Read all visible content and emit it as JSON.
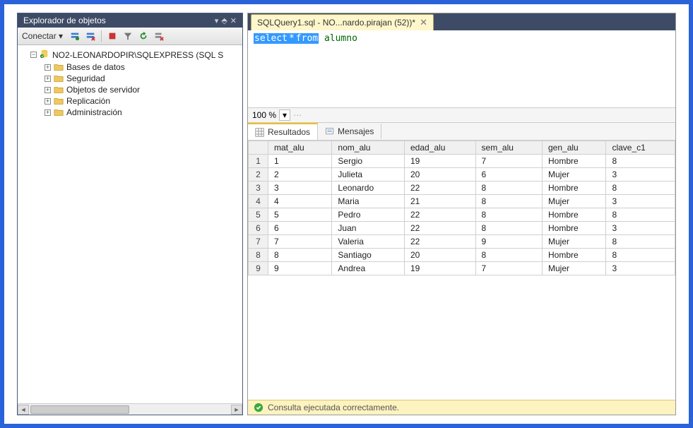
{
  "explorer": {
    "title": "Explorador de objetos",
    "connect_label": "Conectar ▾",
    "root_label": "NO2-LEONARDOPIR\\SQLEXPRESS (SQL S",
    "items": [
      {
        "label": "Bases de datos"
      },
      {
        "label": "Seguridad"
      },
      {
        "label": "Objetos de servidor"
      },
      {
        "label": "Replicación"
      },
      {
        "label": "Administración"
      }
    ]
  },
  "editor_tab": {
    "title": "SQLQuery1.sql - NO...nardo.pirajan (52))*"
  },
  "sql": {
    "keyword1": "select",
    "op": "*",
    "keyword2": "from",
    "ident": "alumno"
  },
  "zoom": {
    "value": "100 %"
  },
  "result_tabs": {
    "results": "Resultados",
    "messages": "Mensajes"
  },
  "grid": {
    "columns": [
      "mat_alu",
      "nom_alu",
      "edad_alu",
      "sem_alu",
      "gen_alu",
      "clave_c1"
    ],
    "rows": [
      [
        "1",
        "Sergio",
        "19",
        "7",
        "Hombre",
        "8"
      ],
      [
        "2",
        "Julieta",
        "20",
        "6",
        "Mujer",
        "3"
      ],
      [
        "3",
        "Leonardo",
        "22",
        "8",
        "Hombre",
        "8"
      ],
      [
        "4",
        "Maria",
        "21",
        "8",
        "Mujer",
        "3"
      ],
      [
        "5",
        "Pedro",
        "22",
        "8",
        "Hombre",
        "8"
      ],
      [
        "6",
        "Juan",
        "22",
        "8",
        "Hombre",
        "3"
      ],
      [
        "7",
        "Valeria",
        "22",
        "9",
        "Mujer",
        "8"
      ],
      [
        "8",
        "Santiago",
        "20",
        "8",
        "Hombre",
        "8"
      ],
      [
        "9",
        "Andrea",
        "19",
        "7",
        "Mujer",
        "3"
      ]
    ]
  },
  "status": {
    "message": "Consulta ejecutada correctamente."
  }
}
